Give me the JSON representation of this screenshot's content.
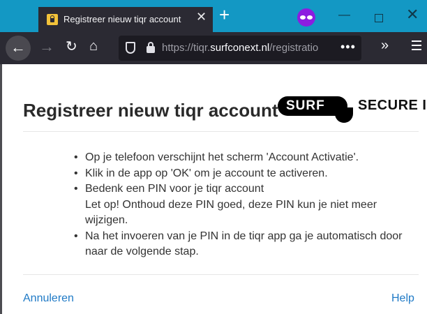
{
  "browser": {
    "tab": {
      "title": "Registreer nieuw tiqr account",
      "close_glyph": "✕"
    },
    "new_tab_glyph": "+",
    "window": {
      "minimize_glyph": "—",
      "close_glyph": "✕"
    },
    "nav": {
      "back_glyph": "←",
      "forward_glyph": "→",
      "reload_glyph": "↻",
      "home_glyph": "⌂",
      "overflow_glyph": "»"
    },
    "url": {
      "prefix": "https://tiqr.",
      "domain": "surfconext.nl",
      "suffix": "/registratio",
      "more": "•••"
    }
  },
  "page": {
    "title": "Registreer nieuw tiqr account",
    "logo": {
      "left": "SURF",
      "right": "SECURE ID"
    },
    "instructions": [
      "Op je telefoon verschijnt het scherm 'Account Activatie'.",
      "Klik in de app op 'OK' om je account te activeren.",
      "Bedenk een PIN voor je tiqr account",
      "Na het invoeren van je PIN in de tiqr app ga je automatisch door naar de volgende stap."
    ],
    "pin_warning": "Let op! Onthoud deze PIN goed, deze PIN kun je niet meer wijzigen.",
    "footer": {
      "cancel": "Annuleren",
      "help": "Help"
    }
  },
  "colors": {
    "tab_bar": "#1398c4",
    "toolbar": "#2b2a33",
    "link": "#1f7ac6",
    "private_mask": "#8c1de0",
    "lock_icon": "#f2c23a"
  },
  "icons": [
    "lock-icon",
    "close-icon",
    "plus-icon",
    "private-browsing-icon",
    "minimize-icon",
    "maximize-icon",
    "back-icon",
    "forward-icon",
    "reload-icon",
    "home-icon",
    "shield-icon",
    "padlock-icon",
    "more-icon",
    "overflow-icon",
    "menu-icon"
  ]
}
